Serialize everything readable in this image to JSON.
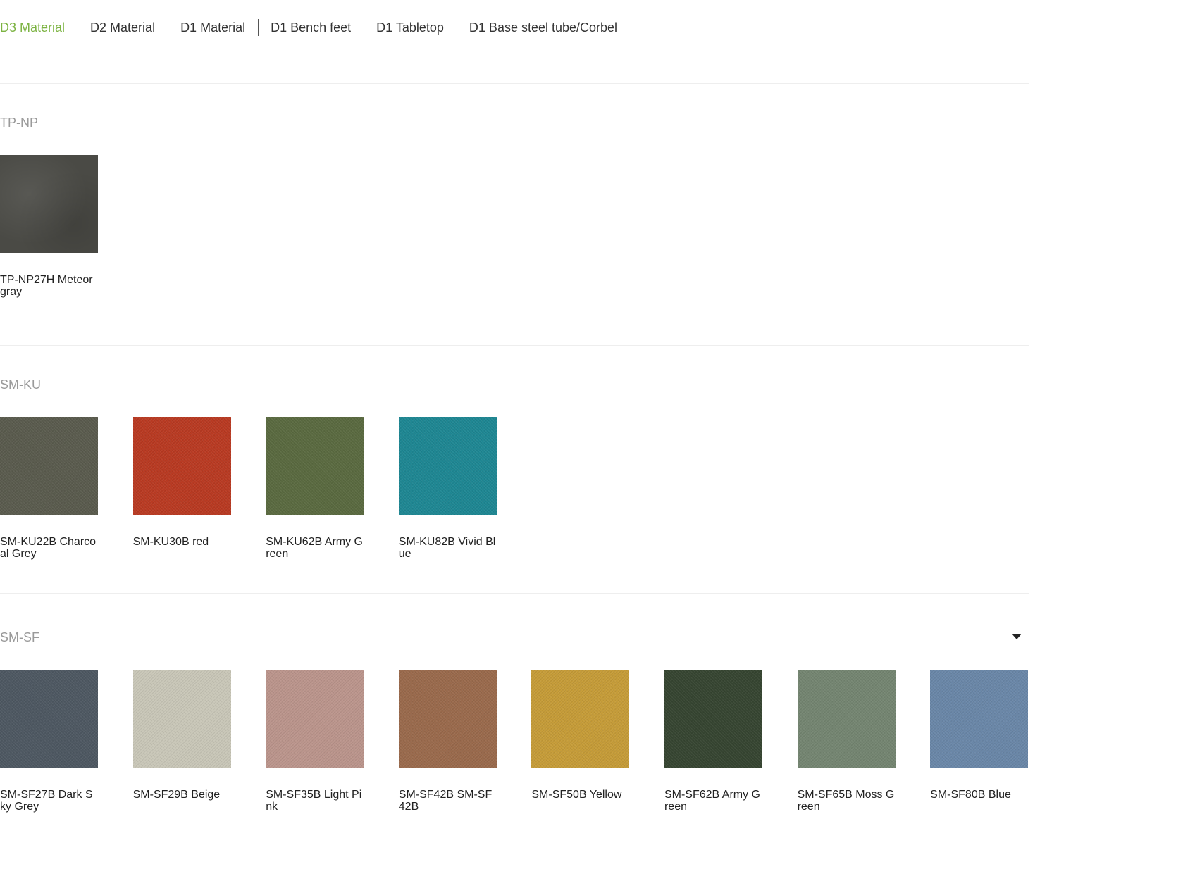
{
  "tabs": [
    {
      "label": "D3 Material",
      "active": true
    },
    {
      "label": "D2 Material",
      "active": false
    },
    {
      "label": "D1 Material",
      "active": false
    },
    {
      "label": "D1 Bench feet",
      "active": false
    },
    {
      "label": "D1 Tabletop",
      "active": false
    },
    {
      "label": "D1 Base steel tube/Corbel",
      "active": false
    }
  ],
  "sections": [
    {
      "title": "TP-NP",
      "items": [
        {
          "label": "TP-NP27H Meteor gray",
          "color": "#4a4a45",
          "icon": "leather-swatch"
        }
      ]
    },
    {
      "title": "SM-KU",
      "items": [
        {
          "label": "SM-KU22B Charcoal Grey",
          "color": "#5a5b4e"
        },
        {
          "label": "SM-KU30B red",
          "color": "#b93a22"
        },
        {
          "label": "SM-KU62B Army Green",
          "color": "#5a6a40"
        },
        {
          "label": "SM-KU82B Vivid Blue",
          "color": "#1e8793"
        }
      ]
    },
    {
      "title": "SM-SF",
      "toggle_icon": "caret-down-icon",
      "items": [
        {
          "label": "SM-SF27B Dark Sky Grey",
          "color": "#4e5862"
        },
        {
          "label": "SM-SF29B Beige",
          "color": "#c9c7b8"
        },
        {
          "label": "SM-SF35B Light Pink",
          "color": "#bb958c"
        },
        {
          "label": "SM-SF42B SM-SF42B",
          "color": "#9a6a4c"
        },
        {
          "label": "SM-SF50B Yellow",
          "color": "#c69c38"
        },
        {
          "label": "SM-SF62B Army Green",
          "color": "#364531"
        },
        {
          "label": "SM-SF65B Moss Green",
          "color": "#748571"
        },
        {
          "label": "SM-SF80B Blue",
          "color": "#6a87a8"
        }
      ]
    }
  ]
}
